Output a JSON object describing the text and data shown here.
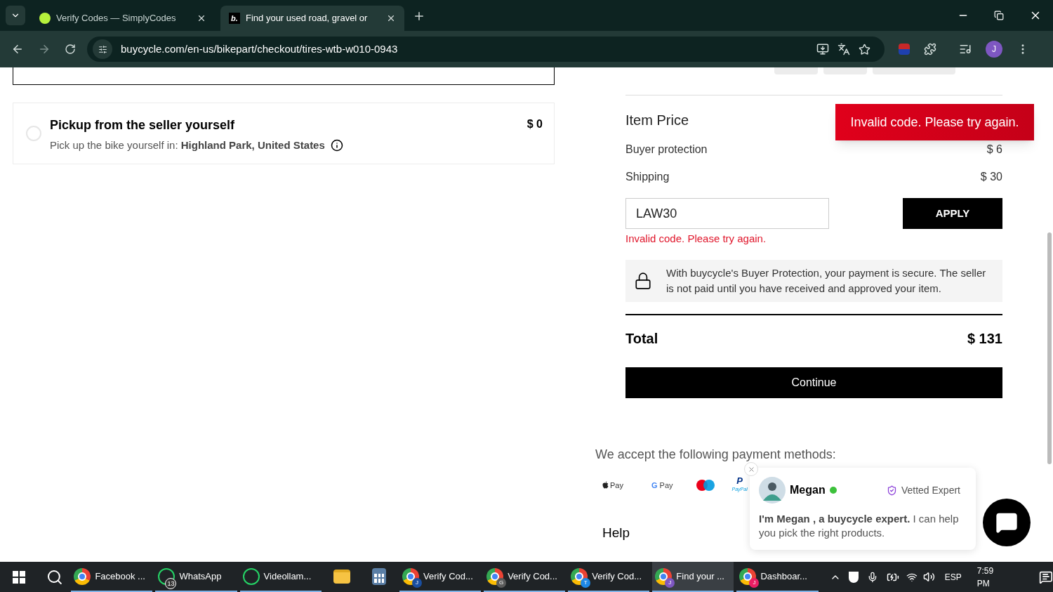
{
  "browser": {
    "tabs": [
      {
        "title": "Verify Codes — SimplyCodes",
        "selected": false,
        "kind": "simplycodes"
      },
      {
        "title": "Find your used road, gravel or",
        "selected": true,
        "kind": "buycycle",
        "favicon_letter": "b."
      }
    ],
    "url": "buycycle.com/en-us/bikepart/checkout/tires-wtb-w010-0943",
    "profile_initial": "J"
  },
  "delivery_options": [
    {
      "title": "Pickup from the seller yourself",
      "description": "Pick up the bike yourself in: **Highland Park, United States**",
      "price": "$ 0",
      "selected": false
    }
  ],
  "summary": {
    "item_price_label": "Item Price",
    "lines": [
      {
        "label": "Buyer protection",
        "value": "$ 6"
      },
      {
        "label": "Shipping",
        "value": "$ 30"
      }
    ],
    "promo": {
      "value": "LAW30",
      "button": "APPLY",
      "error": "Invalid code. Please try again."
    },
    "protection_note": "With buycycle's Buyer Protection, your payment is secure. The seller is not paid until you have received and approved your item.",
    "total_label": "Total",
    "total_value": "$ 131",
    "continue": "Continue"
  },
  "toast": "Invalid code. Please try again.",
  "payment": {
    "heading": "We accept the following payment methods:",
    "methods": [
      {
        "kind": "apple",
        "label": "Pay"
      },
      {
        "kind": "google",
        "mark": "G",
        "label": "Pay"
      },
      {
        "kind": "maestro"
      },
      {
        "kind": "paypal",
        "mark": "P",
        "label": "PayPal"
      }
    ]
  },
  "help": "Help",
  "chat": {
    "name": "Megan",
    "online": true,
    "badge": "Vetted Expert",
    "message": "**I'm Megan , a buycycle expert.** I can help you pick the right products."
  },
  "taskbar": {
    "items": [
      {
        "label": "Facebook ...",
        "kind": "chrome",
        "open": true,
        "selected": false
      },
      {
        "label": "WhatsApp",
        "kind": "whatsapp",
        "badge": "13",
        "open": true,
        "selected": false
      },
      {
        "label": "Videollam...",
        "kind": "whatsapp",
        "open": true,
        "selected": false
      },
      {
        "kind": "folder",
        "open": false,
        "selected": false
      },
      {
        "kind": "calculator",
        "open": false,
        "selected": false
      },
      {
        "label": "Verify Cod...",
        "kind": "chrome",
        "profile": "J",
        "color": "#1a4fa0",
        "open": true,
        "selected": false
      },
      {
        "label": "Verify Cod...",
        "kind": "chrome",
        "profile": "G",
        "color": "#5a5a5a",
        "open": true,
        "selected": false
      },
      {
        "label": "Verify Cod...",
        "kind": "chrome",
        "profile": "T",
        "color": "#1e88e5",
        "open": true,
        "selected": false
      },
      {
        "label": "Find your ...",
        "kind": "chrome",
        "profile": "J",
        "color": "#7e57c2",
        "open": true,
        "selected": true
      },
      {
        "label": "Dashboar...",
        "kind": "chrome",
        "profile": "J",
        "color": "#e91e63",
        "open": true,
        "selected": false
      }
    ],
    "language": "ESP",
    "time": "7:59 PM"
  }
}
